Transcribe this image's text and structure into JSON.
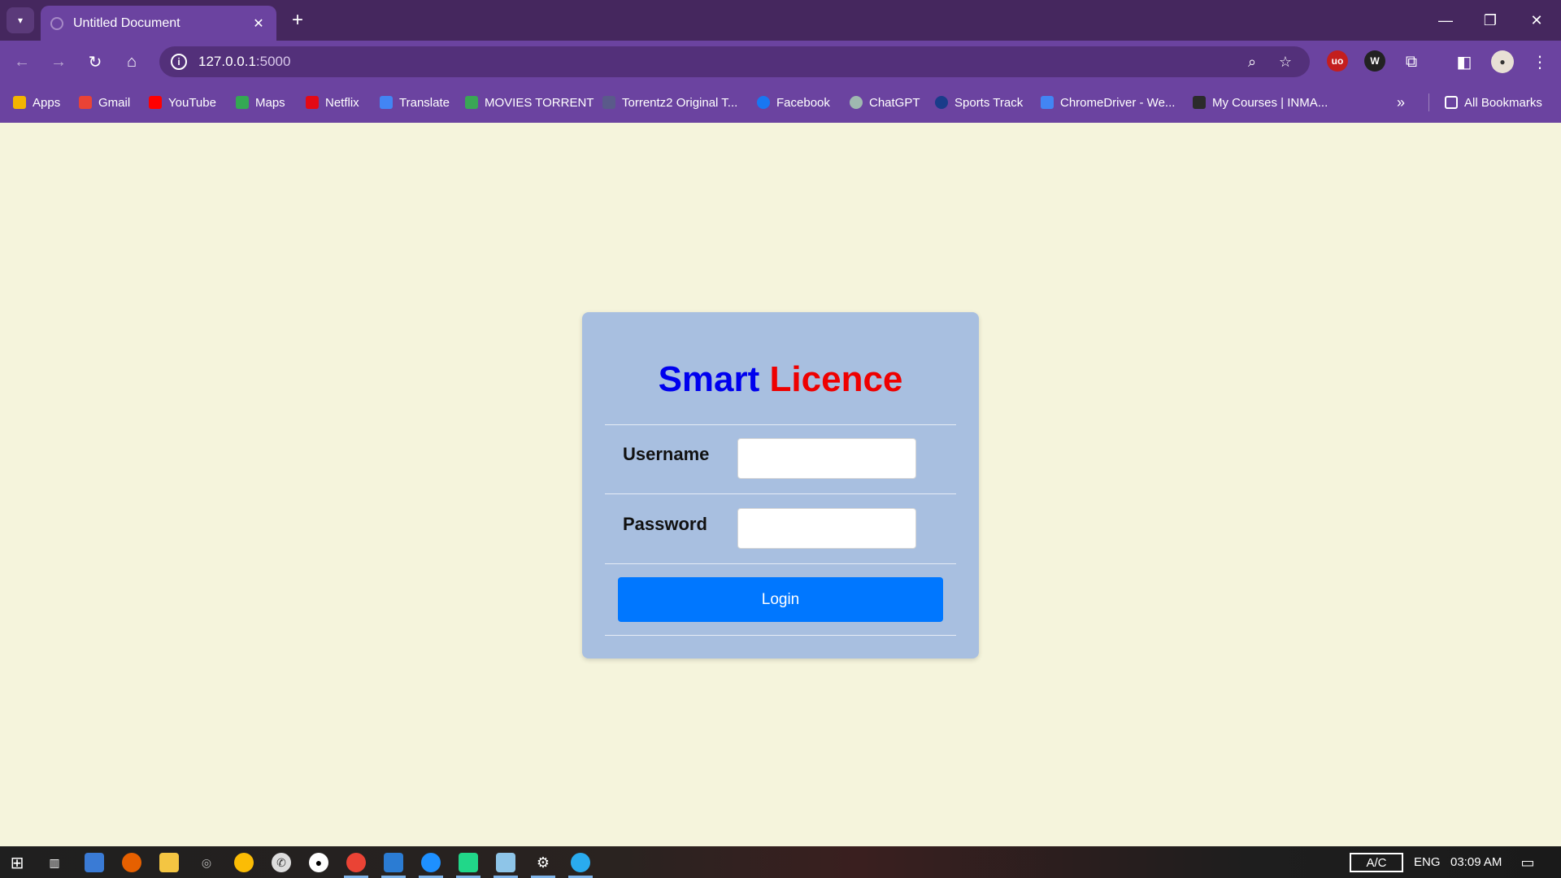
{
  "browser": {
    "tab_title": "Untitled Document",
    "url_host": "127.0.0.1",
    "url_port": ":5000",
    "bookmarks": [
      {
        "label": "Apps",
        "icon": "apps-grid-icon",
        "color": "#f4b400"
      },
      {
        "label": "Gmail",
        "icon": "gmail-icon",
        "color": "#ea4335"
      },
      {
        "label": "YouTube",
        "icon": "youtube-icon",
        "color": "#ff0000"
      },
      {
        "label": "Maps",
        "icon": "maps-icon",
        "color": "#34a853"
      },
      {
        "label": "Netflix",
        "icon": "netflix-icon",
        "color": "#e50914"
      },
      {
        "label": "Translate",
        "icon": "translate-icon",
        "color": "#4285f4"
      },
      {
        "label": "MOVIES TORRENT",
        "icon": "torrent-icon",
        "color": "#3aa655"
      },
      {
        "label": "Torrentz2 Original T...",
        "icon": "torrentz-icon",
        "color": "#5a5a8a"
      },
      {
        "label": "Facebook",
        "icon": "facebook-icon",
        "color": "#1877f2"
      },
      {
        "label": "ChatGPT",
        "icon": "chatgpt-icon",
        "color": "#9fb8b0"
      },
      {
        "label": "Sports Track",
        "icon": "sports-track-icon",
        "color": "#1a3c8a"
      },
      {
        "label": "ChromeDriver - We...",
        "icon": "chromedriver-icon",
        "color": "#4285f4"
      },
      {
        "label": "My Courses | INMA...",
        "icon": "courses-icon",
        "color": "#2b2b2b"
      }
    ],
    "all_bookmarks_label": "All Bookmarks"
  },
  "login": {
    "title_part1": "Smart",
    "title_part2": "Licence",
    "username_label": "Username",
    "username_value": "",
    "password_label": "Password",
    "password_value": "",
    "login_button": "Login",
    "colors": {
      "title1": "#0000ee",
      "title2": "#ee0000",
      "button": "#0077ff",
      "card": "#a8bfe0"
    }
  },
  "taskbar": {
    "battery_label": "A/C",
    "language": "ENG",
    "time": "03:09 AM"
  }
}
